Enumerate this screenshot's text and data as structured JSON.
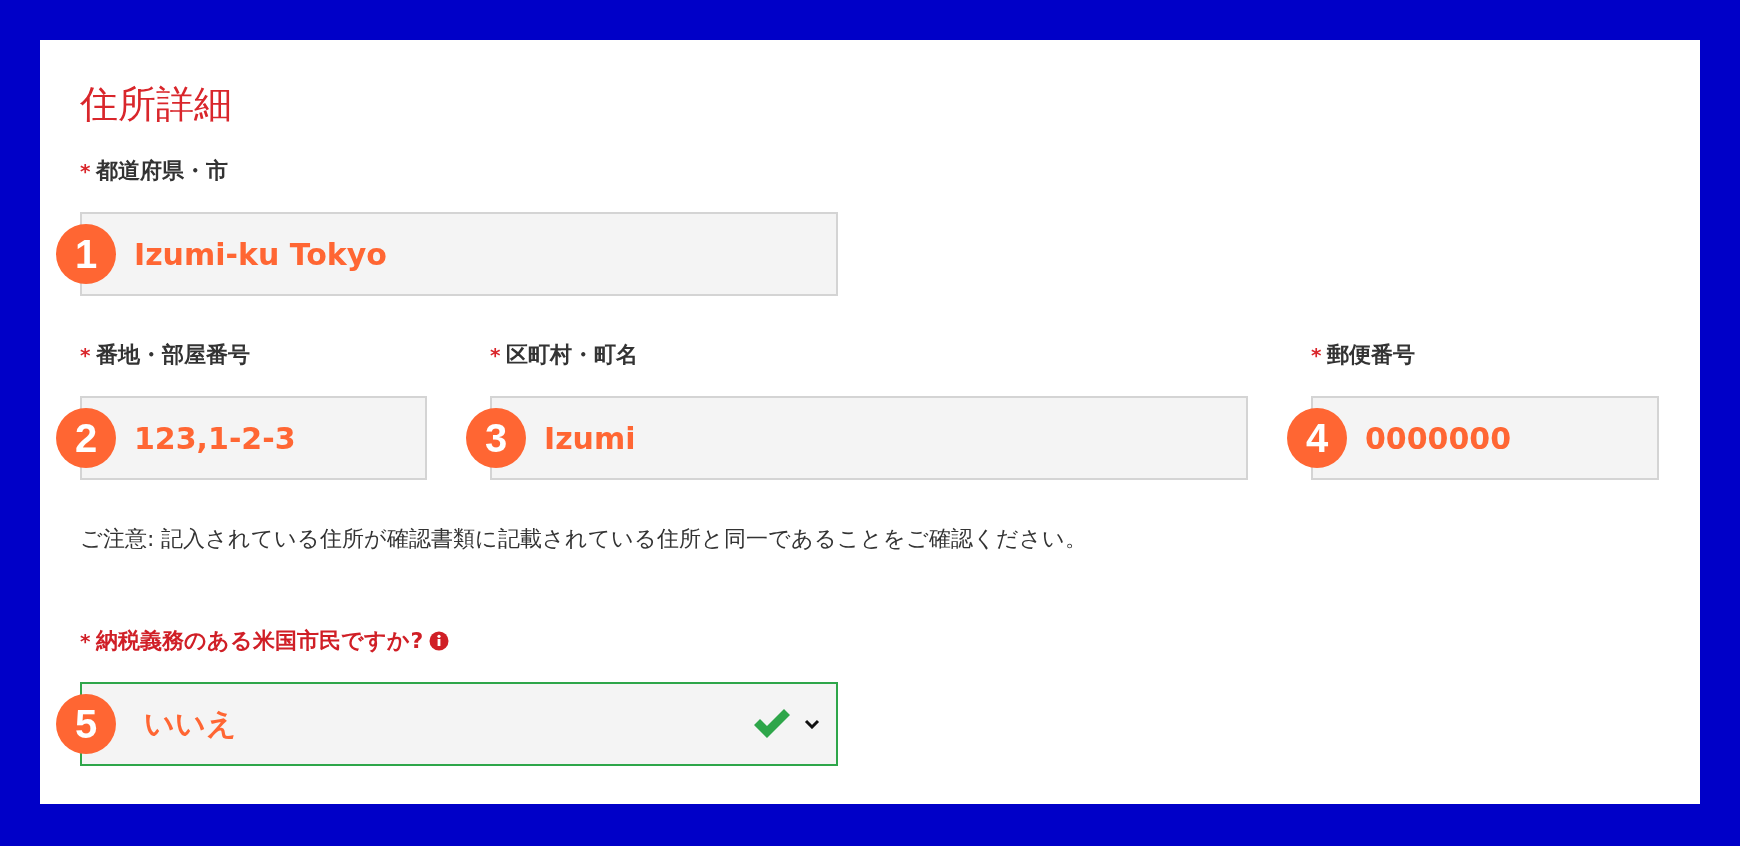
{
  "section_title": "住所詳細",
  "rows": [
    {
      "fields": [
        {
          "mark": "*",
          "label": "都道府県・市",
          "marker": "1",
          "value": "Izumi-ku Tokyo"
        }
      ]
    },
    {
      "fields": [
        {
          "mark": "*",
          "label": "番地・部屋番号",
          "marker": "2",
          "value": "123,1-2-3"
        },
        {
          "mark": "*",
          "label": "区町村・町名",
          "marker": "3",
          "value": "Izumi"
        },
        {
          "mark": "*",
          "label": "郵便番号",
          "marker": "4",
          "value": "0000000"
        }
      ]
    }
  ],
  "note": "ご注意: 記入されている住所が確認書類に記載されている住所と同一であることをご確認ください。",
  "tax_question": {
    "mark": "*",
    "label": "納税義務のある米国市民ですか?",
    "highlighted": true,
    "marker": "5",
    "value": "いいえ",
    "valid": true
  }
}
